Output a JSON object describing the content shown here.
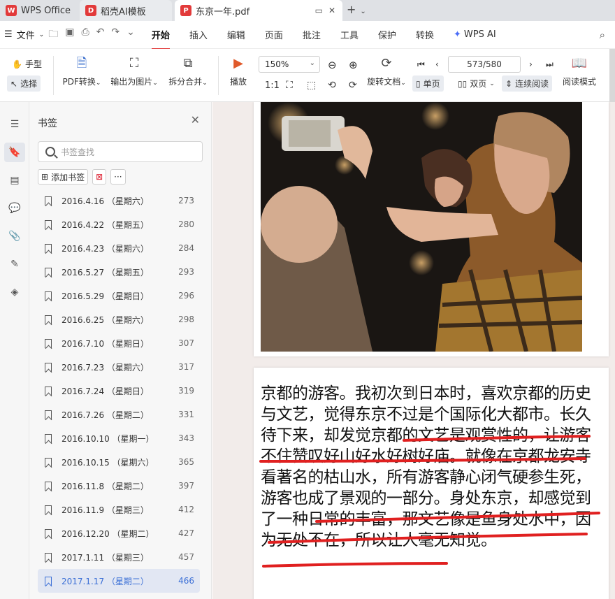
{
  "tabs": [
    {
      "label": "WPS Office",
      "icon": "wps-logo-icon",
      "color": "#e23a3a"
    },
    {
      "label": "稻壳AI模板",
      "icon": "docer-icon",
      "color": "#e23a3a"
    },
    {
      "label": "东京一年.pdf",
      "icon": "pdf-icon",
      "color": "#e23a3a"
    }
  ],
  "menu": {
    "file": "文件",
    "items": [
      "开始",
      "插入",
      "编辑",
      "页面",
      "批注",
      "工具",
      "保护",
      "转换"
    ],
    "active": "开始",
    "ai": "WPS AI"
  },
  "toolbar": {
    "hand": "手型",
    "select": "选择",
    "pdf_convert": "PDF转换",
    "export_image": "输出为图片",
    "split_merge": "拆分合并",
    "play": "播放",
    "zoom": "150%",
    "rotate": "旋转文档",
    "page_indicator": "573/580",
    "single": "单页",
    "double": "双页",
    "continuous": "连续阅读",
    "read_mode": "阅读模式"
  },
  "panel": {
    "title": "书签",
    "search_placeholder": "书签查找",
    "add_bookmark": "添加书签"
  },
  "bookmarks": [
    {
      "label": "2016.4.16 （星期六）",
      "page": "273"
    },
    {
      "label": "2016.4.22 （星期五）",
      "page": "280"
    },
    {
      "label": "2016.4.23 （星期六）",
      "page": "284"
    },
    {
      "label": "2016.5.27 （星期五）",
      "page": "293"
    },
    {
      "label": "2016.5.29 （星期日）",
      "page": "296"
    },
    {
      "label": "2016.6.25 （星期六）",
      "page": "298"
    },
    {
      "label": "2016.7.10 （星期日）",
      "page": "307"
    },
    {
      "label": "2016.7.23 （星期六）",
      "page": "317"
    },
    {
      "label": "2016.7.24 （星期日）",
      "page": "319"
    },
    {
      "label": "2016.7.26 （星期二）",
      "page": "331"
    },
    {
      "label": "2016.10.10 （星期一）",
      "page": "343"
    },
    {
      "label": "2016.10.15 （星期六）",
      "page": "365"
    },
    {
      "label": "2016.11.8 （星期二）",
      "page": "397"
    },
    {
      "label": "2016.11.9 （星期三）",
      "page": "412"
    },
    {
      "label": "2016.12.20 （星期二）",
      "page": "427"
    },
    {
      "label": "2017.1.11 （星期三）",
      "page": "457"
    },
    {
      "label": "2017.1.17 （星期二）",
      "page": "466",
      "selected": true
    }
  ],
  "document": {
    "paragraph": "京都的游客。我初次到日本时，喜欢京都的历史与文艺，觉得东京不过是个国际化大都市。长久待下来，却发觉京都的文艺是观赏性的，让游客不住赞叹好山好水好树好庙。就像在京都龙安寺看著名的枯山水，所有游客静心闭气硬参生死，游客也成了景观的一部分。身处东京，却感觉到了一种日常的丰富，那文艺像是鱼身处水中，因为无处不在，所以让人毫无知觉。",
    "underline_color": "#e02020"
  }
}
